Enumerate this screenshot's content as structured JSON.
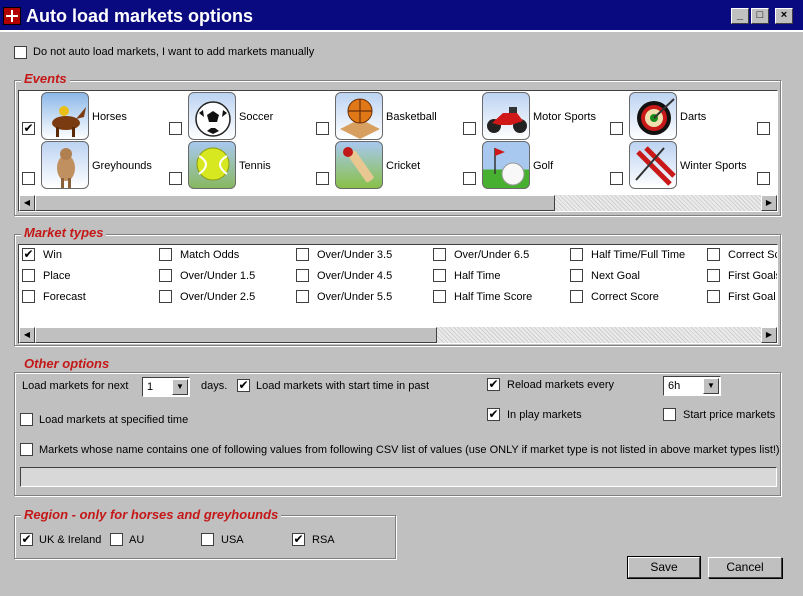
{
  "window": {
    "title": "Auto load markets options",
    "minimize": "_",
    "maximize": "□",
    "close": "×"
  },
  "manual": {
    "label": "Do not auto load markets, I want to add markets manually",
    "checked": false
  },
  "events": {
    "title": "Events",
    "items": [
      {
        "label": "Horses",
        "checked": true,
        "icon": "horse-icon"
      },
      {
        "label": "Soccer",
        "checked": false,
        "icon": "soccer-ball-icon"
      },
      {
        "label": "Basketball",
        "checked": false,
        "icon": "basketball-icon"
      },
      {
        "label": "Motor Sports",
        "checked": false,
        "icon": "motorbike-icon"
      },
      {
        "label": "Darts",
        "checked": false,
        "icon": "dartboard-icon"
      },
      {
        "label": "Greyhounds",
        "checked": false,
        "icon": "greyhound-icon"
      },
      {
        "label": "Tennis",
        "checked": false,
        "icon": "tennis-ball-icon"
      },
      {
        "label": "Cricket",
        "checked": false,
        "icon": "cricket-bat-icon"
      },
      {
        "label": "Golf",
        "checked": false,
        "icon": "golf-ball-icon"
      },
      {
        "label": "Winter Sports",
        "checked": false,
        "icon": "skis-icon"
      }
    ]
  },
  "market_types": {
    "title": "Market types",
    "columns": [
      [
        {
          "label": "Win",
          "checked": true
        },
        {
          "label": "Place",
          "checked": false
        },
        {
          "label": "Forecast",
          "checked": false
        }
      ],
      [
        {
          "label": "Match Odds",
          "checked": false
        },
        {
          "label": "Over/Under 1.5",
          "checked": false
        },
        {
          "label": "Over/Under 2.5",
          "checked": false
        }
      ],
      [
        {
          "label": "Over/Under 3.5",
          "checked": false
        },
        {
          "label": "Over/Under 4.5",
          "checked": false
        },
        {
          "label": "Over/Under 5.5",
          "checked": false
        }
      ],
      [
        {
          "label": "Over/Under 6.5",
          "checked": false
        },
        {
          "label": "Half Time",
          "checked": false
        },
        {
          "label": "Half Time Score",
          "checked": false
        }
      ],
      [
        {
          "label": "Half Time/Full Time",
          "checked": false
        },
        {
          "label": "Next Goal",
          "checked": false
        },
        {
          "label": "Correct Score",
          "checked": false
        }
      ],
      [
        {
          "label": "Correct Sc",
          "checked": false
        },
        {
          "label": "First Goals",
          "checked": false
        },
        {
          "label": "First Goal (",
          "checked": false
        }
      ]
    ]
  },
  "other": {
    "title": "Other options",
    "load_next_label": "Load markets for next",
    "days_value": "1",
    "days_label": "days.",
    "past_label": "Load markets with start time in past",
    "past_checked": true,
    "reload_label": "Reload markets every",
    "reload_checked": true,
    "reload_value": "6h",
    "specified_label": "Load markets at specified time",
    "specified_checked": false,
    "inplay_label": "In play markets",
    "inplay_checked": true,
    "startprice_label": "Start price markets",
    "startprice_checked": false,
    "csv_label": "Markets whose name contains one of following values from following CSV list of values (use ONLY if market type is not listed in above market types list!)",
    "csv_checked": false,
    "csv_value": ""
  },
  "region": {
    "title": "Region - only for horses and greyhounds",
    "items": [
      {
        "label": "UK & Ireland",
        "checked": true
      },
      {
        "label": "AU",
        "checked": false
      },
      {
        "label": "USA",
        "checked": false
      },
      {
        "label": "RSA",
        "checked": true
      }
    ]
  },
  "buttons": {
    "save": "Save",
    "cancel": "Cancel"
  }
}
